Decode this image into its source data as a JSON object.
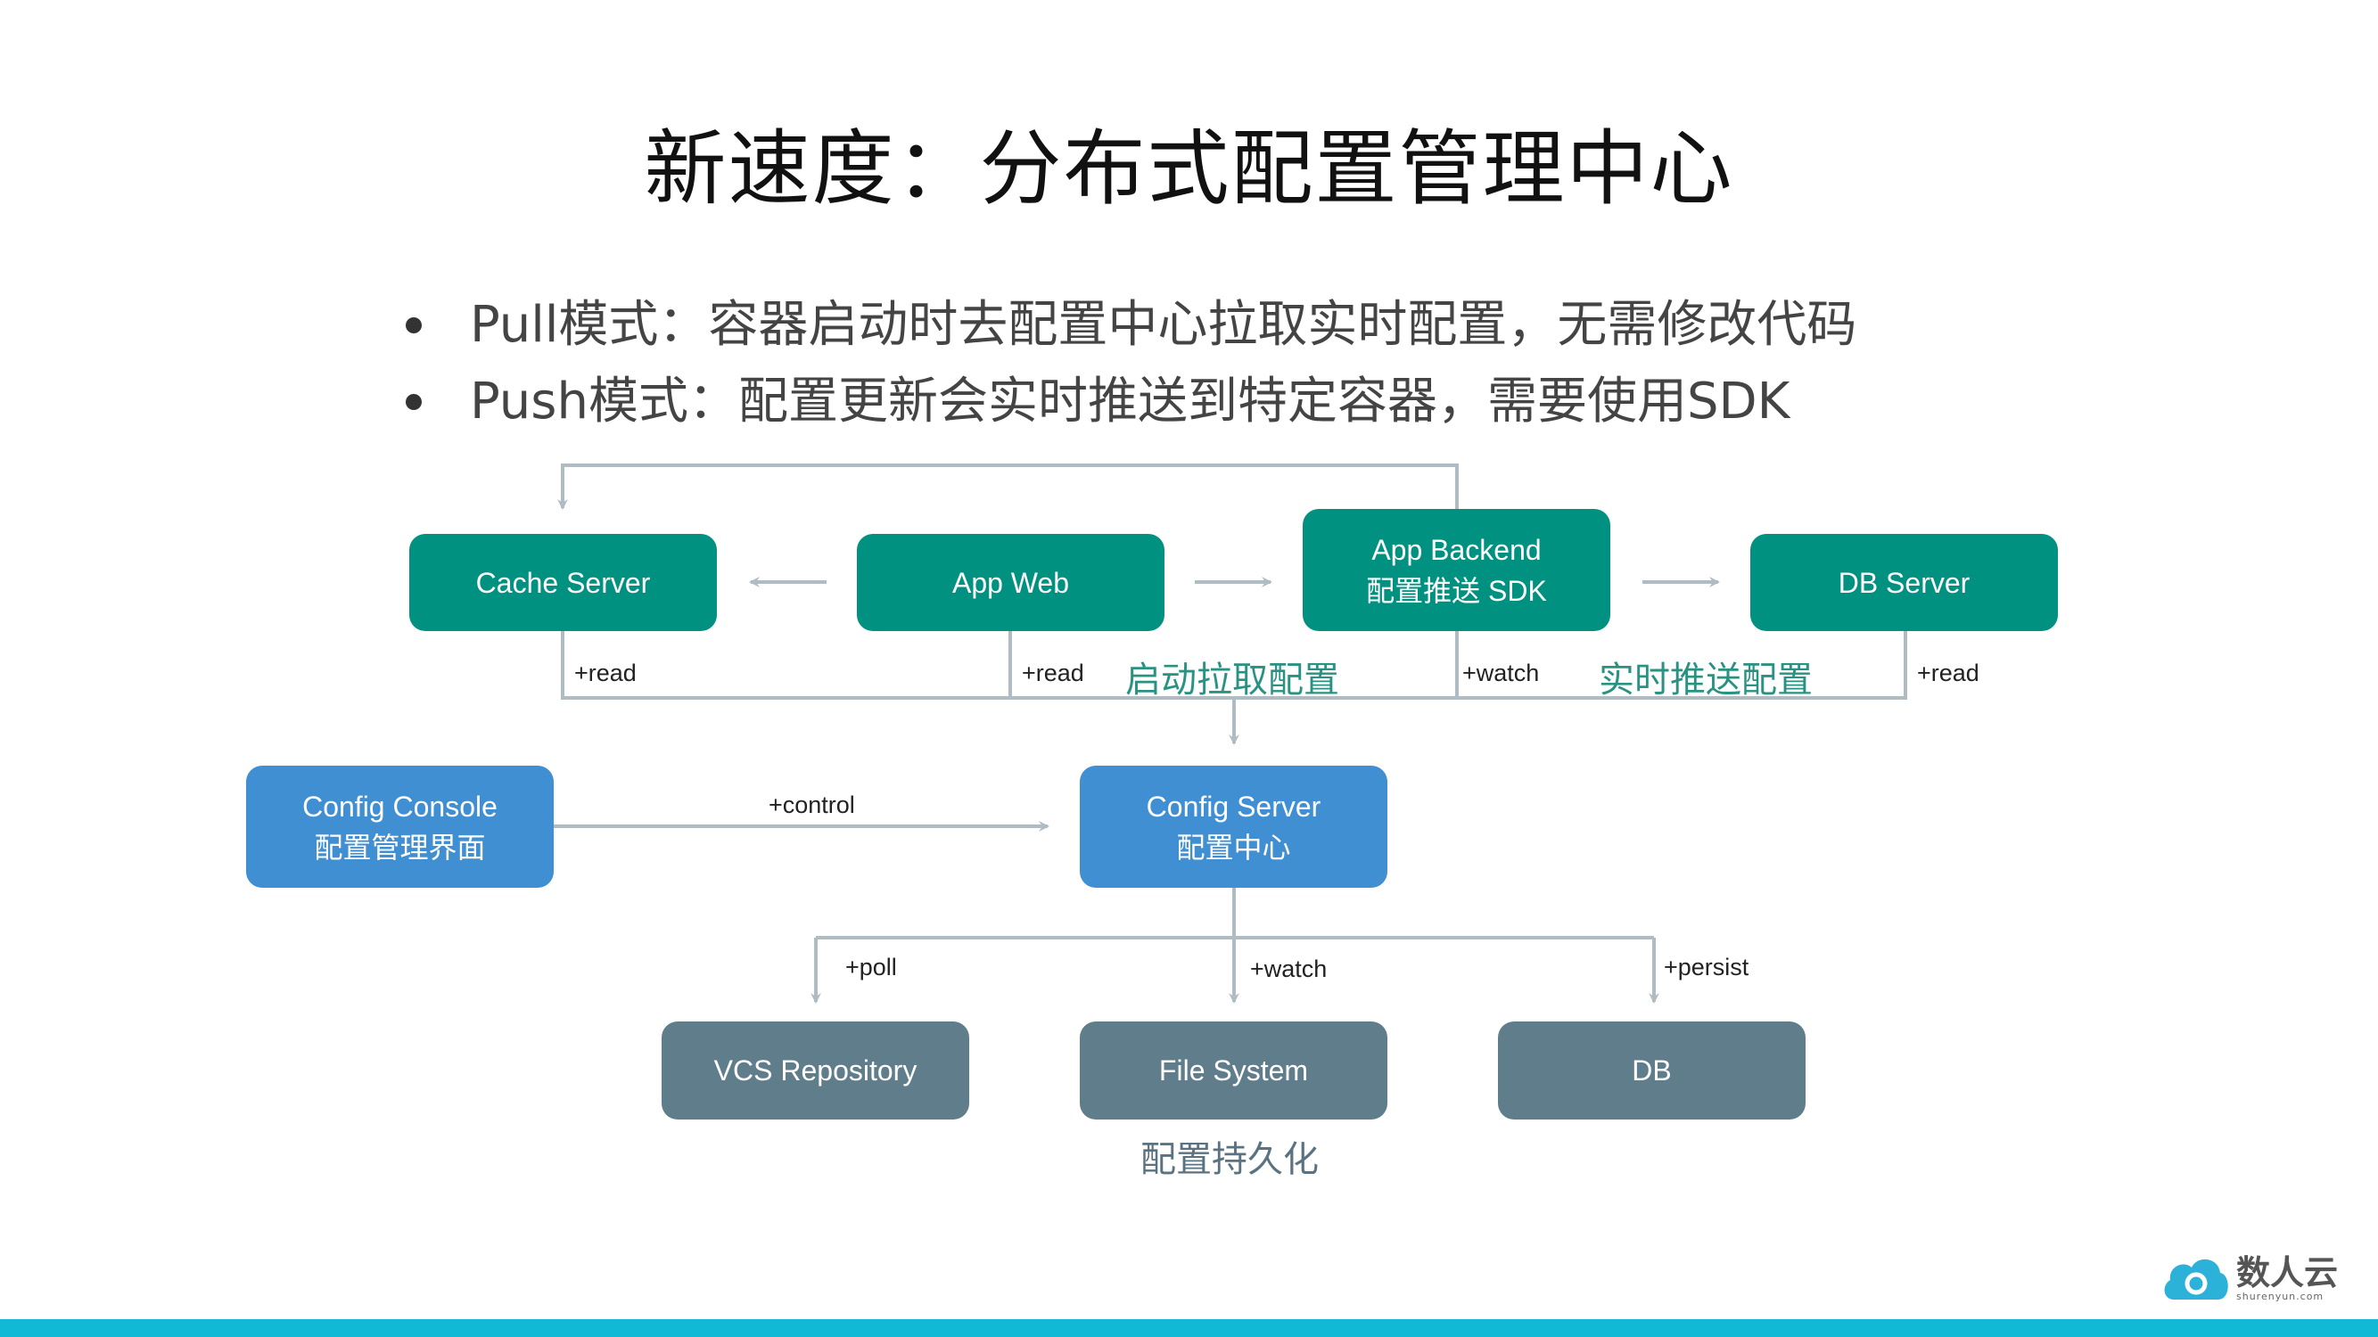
{
  "title": "新速度：分布式配置管理中心",
  "bullets": [
    "Pull模式：容器启动时去配置中心拉取实时配置，无需修改代码",
    "Push模式：配置更新会实时推送到特定容器，需要使用SDK"
  ],
  "colors": {
    "app_tier": "#009180",
    "config_tier": "#3f8fd2",
    "storage_tier": "#607d8b",
    "connector": "#b0bcc4",
    "highlight_text": "#2a9282",
    "footer_bar": "#12b9d6"
  },
  "nodes": {
    "cache_server": {
      "line1": "Cache Server"
    },
    "app_web": {
      "line1": "App Web"
    },
    "app_backend": {
      "line1": "App Backend",
      "line2": "配置推送 SDK"
    },
    "db_server": {
      "line1": "DB Server"
    },
    "config_console": {
      "line1": "Config Console",
      "line2": "配置管理界面"
    },
    "config_server": {
      "line1": "Config Server",
      "line2": "配置中心"
    },
    "vcs_repository": {
      "line1": "VCS Repository"
    },
    "file_system": {
      "line1": "File System"
    },
    "db": {
      "line1": "DB"
    }
  },
  "edge_labels": {
    "cache_read": "+read",
    "web_read": "+read",
    "backend_watch": "+watch",
    "db_read": "+read",
    "control": "+control",
    "poll": "+poll",
    "watch": "+watch",
    "persist": "+persist"
  },
  "annotations": {
    "pull": "启动拉取配置",
    "push": "实时推送配置",
    "persistence": "配置持久化"
  },
  "logo": {
    "name": "数人云",
    "domain": "shurenyun.com"
  }
}
